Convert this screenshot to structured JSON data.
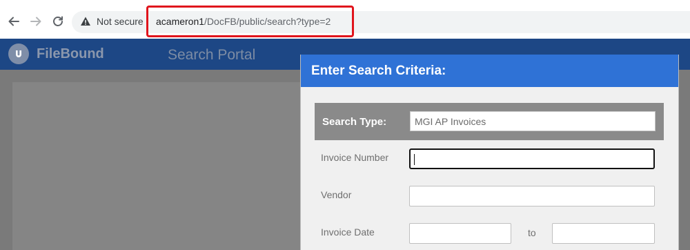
{
  "browser": {
    "security_label": "Not secure",
    "url_host": "acameron1",
    "url_path": "/DocFB/public/search?type=2"
  },
  "app": {
    "logo_text": "FileBound",
    "portal_title": "Search Portal"
  },
  "dialog": {
    "title": "Enter Search Criteria:",
    "search_type_label": "Search Type:",
    "search_type_value": "MGI AP Invoices",
    "fields": {
      "invoice_number_label": "Invoice Number",
      "invoice_number_value": "",
      "vendor_label": "Vendor",
      "vendor_value": "",
      "invoice_date_label": "Invoice Date",
      "invoice_date_from": "",
      "range_separator": "to",
      "invoice_date_to": ""
    }
  },
  "colors": {
    "header_bar": "#1d4785",
    "dialog_header": "#2f72d6",
    "url_highlight": "#e0141c"
  },
  "icons": [
    "back-arrow-icon",
    "forward-arrow-icon",
    "reload-icon",
    "warning-icon",
    "filebound-logo-icon"
  ]
}
